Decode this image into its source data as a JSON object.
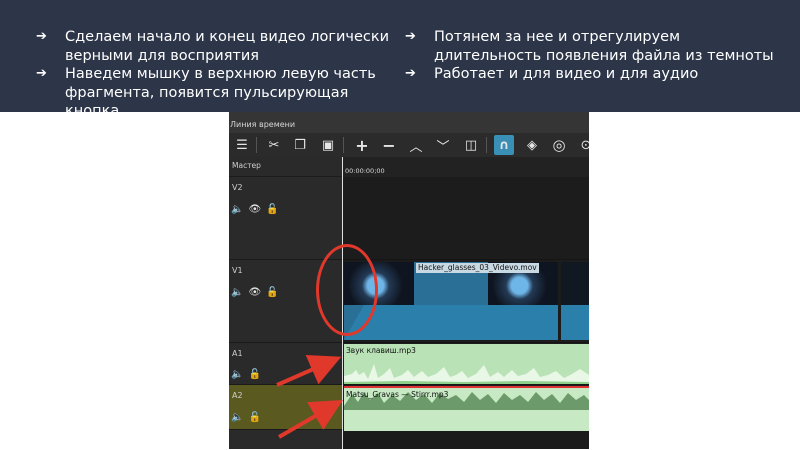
{
  "slide": {
    "left_bullets": [
      "Сделаем начало и конец видео логически верными для восприятия",
      "Наведем мышку в верхнюю левую часть фрагмента, появится пульсирующая кнопка"
    ],
    "right_bullets": [
      "Потянем за нее и отрегулируем длительность появления файла из темноты",
      "Работает и для видео и для аудио"
    ],
    "arrow_glyph": "➔"
  },
  "panel": {
    "title": "Линия времени",
    "toolbar": [
      "menu-icon",
      "cut-icon",
      "copy-icon",
      "paste-icon",
      "add-icon",
      "remove-icon",
      "lift-icon",
      "overwrite-icon",
      "split-icon",
      "snap-icon",
      "scrub-icon",
      "ripple-icon",
      "zoom-icon"
    ],
    "master_label": "Мастер",
    "timecode": "00:00:00;00",
    "tracks": [
      {
        "name": "V2"
      },
      {
        "name": "V1"
      },
      {
        "name": "A1"
      },
      {
        "name": "A2"
      }
    ],
    "clips": {
      "video": "Hacker_glasses_03_Videvo.mov",
      "audio1": "Звук клавиш.mp3",
      "audio2": "Matsu_Gravas — Stirrr.mp3"
    }
  },
  "colors": {
    "banner": "#2d3548",
    "highlight": "#e0382b",
    "video_clip": "#2a6f96",
    "audio_clip": "#b9e3b6",
    "selected_track": "#5a5a20"
  }
}
